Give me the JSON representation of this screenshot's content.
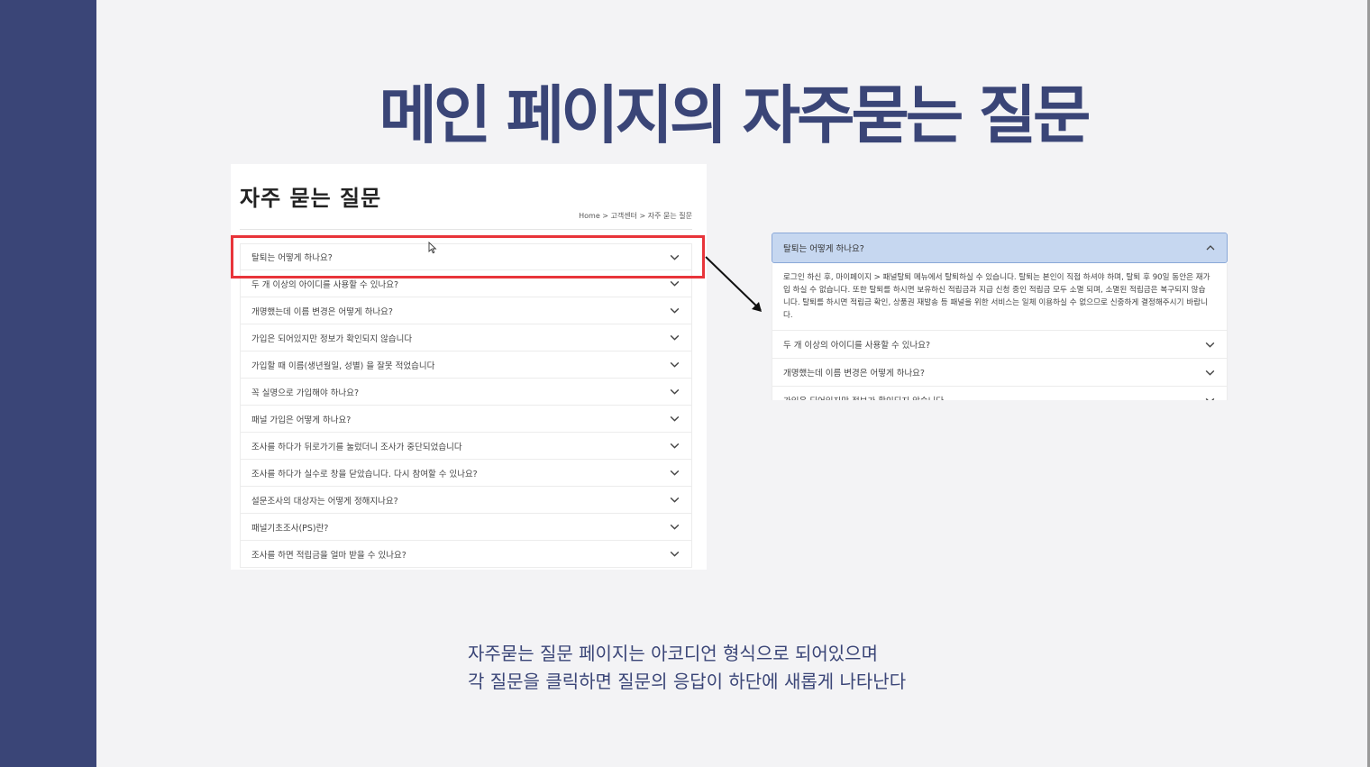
{
  "slide": {
    "title": "메인 페이지의 자주묻는 질문",
    "caption_line1": "자주묻는 질문 페이지는 아코디언 형식으로 되어있으며",
    "caption_line2": "각 질문을 클릭하면 질문의 응답이 하단에 새롭게 나타난다"
  },
  "faq_page": {
    "heading": "자주 묻는 질문",
    "breadcrumb": "Home > 고객센터 > 자주 묻는 질문",
    "items": [
      {
        "label": "탈퇴는 어떻게 하나요?"
      },
      {
        "label": "두 개 이상의 아이디를 사용할 수 있나요?"
      },
      {
        "label": "개명했는데 이름 변경은 어떻게 하나요?"
      },
      {
        "label": "가입은 되어있지만 정보가 확인되지 않습니다"
      },
      {
        "label": "가입할 때 이름(생년월일, 성별) 을 잘못 적었습니다"
      },
      {
        "label": "꼭 실명으로 가입해야 하나요?"
      },
      {
        "label": "패널 가입은 어떻게 하나요?"
      },
      {
        "label": "조사를 하다가 뒤로가기를 눌렀더니 조사가 중단되었습니다"
      },
      {
        "label": "조사를 하다가 실수로 창을 닫았습니다. 다시 참여할 수 있나요?"
      },
      {
        "label": "설문조사의 대상자는 어떻게 정해지나요?"
      },
      {
        "label": "패널기초조사(PS)란?"
      },
      {
        "label": "조사를 하면 적립금을 얼마 받을 수 있나요?"
      }
    ]
  },
  "expanded": {
    "question": "탈퇴는 어떻게 하나요?",
    "answer": "로그인 하신 후, 마이페이지 > 패널탈퇴 메뉴에서 탈퇴하실 수 있습니다. 탈퇴는 본인이 직접 하셔야 하며, 탈퇴 후 90일 동안은 재가입 하실 수 없습니다. 또한 탈퇴를 하시면 보유하신 적립금과 지급 신청 중인 적립금 모두 소멸 되며, 소멸된 적립금은 복구되지 않습니다. 탈퇴를 하시면 적립금 확인, 상품권 재발송 등 패널을 위한 서비스는 일체 이용하실 수 없으므로 신중하게 결정해주시기 바랍니다.",
    "following": [
      {
        "label": "두 개 이상의 아이디를 사용할 수 있나요?"
      },
      {
        "label": "개명했는데 이름 변경은 어떻게 하나요?"
      },
      {
        "label": "가입은 되어있지만 정보가 확인되지 않습니다"
      }
    ]
  },
  "colors": {
    "sidebar": "#3a4577",
    "title": "#3a4577",
    "highlight": "#e8343a",
    "expanded_bg": "#c6d7f0"
  },
  "icons": {
    "row_toggle": "chevron-down-icon",
    "expanded_toggle": "chevron-up-icon",
    "pointer": "cursor-icon",
    "flow": "arrow-icon"
  }
}
